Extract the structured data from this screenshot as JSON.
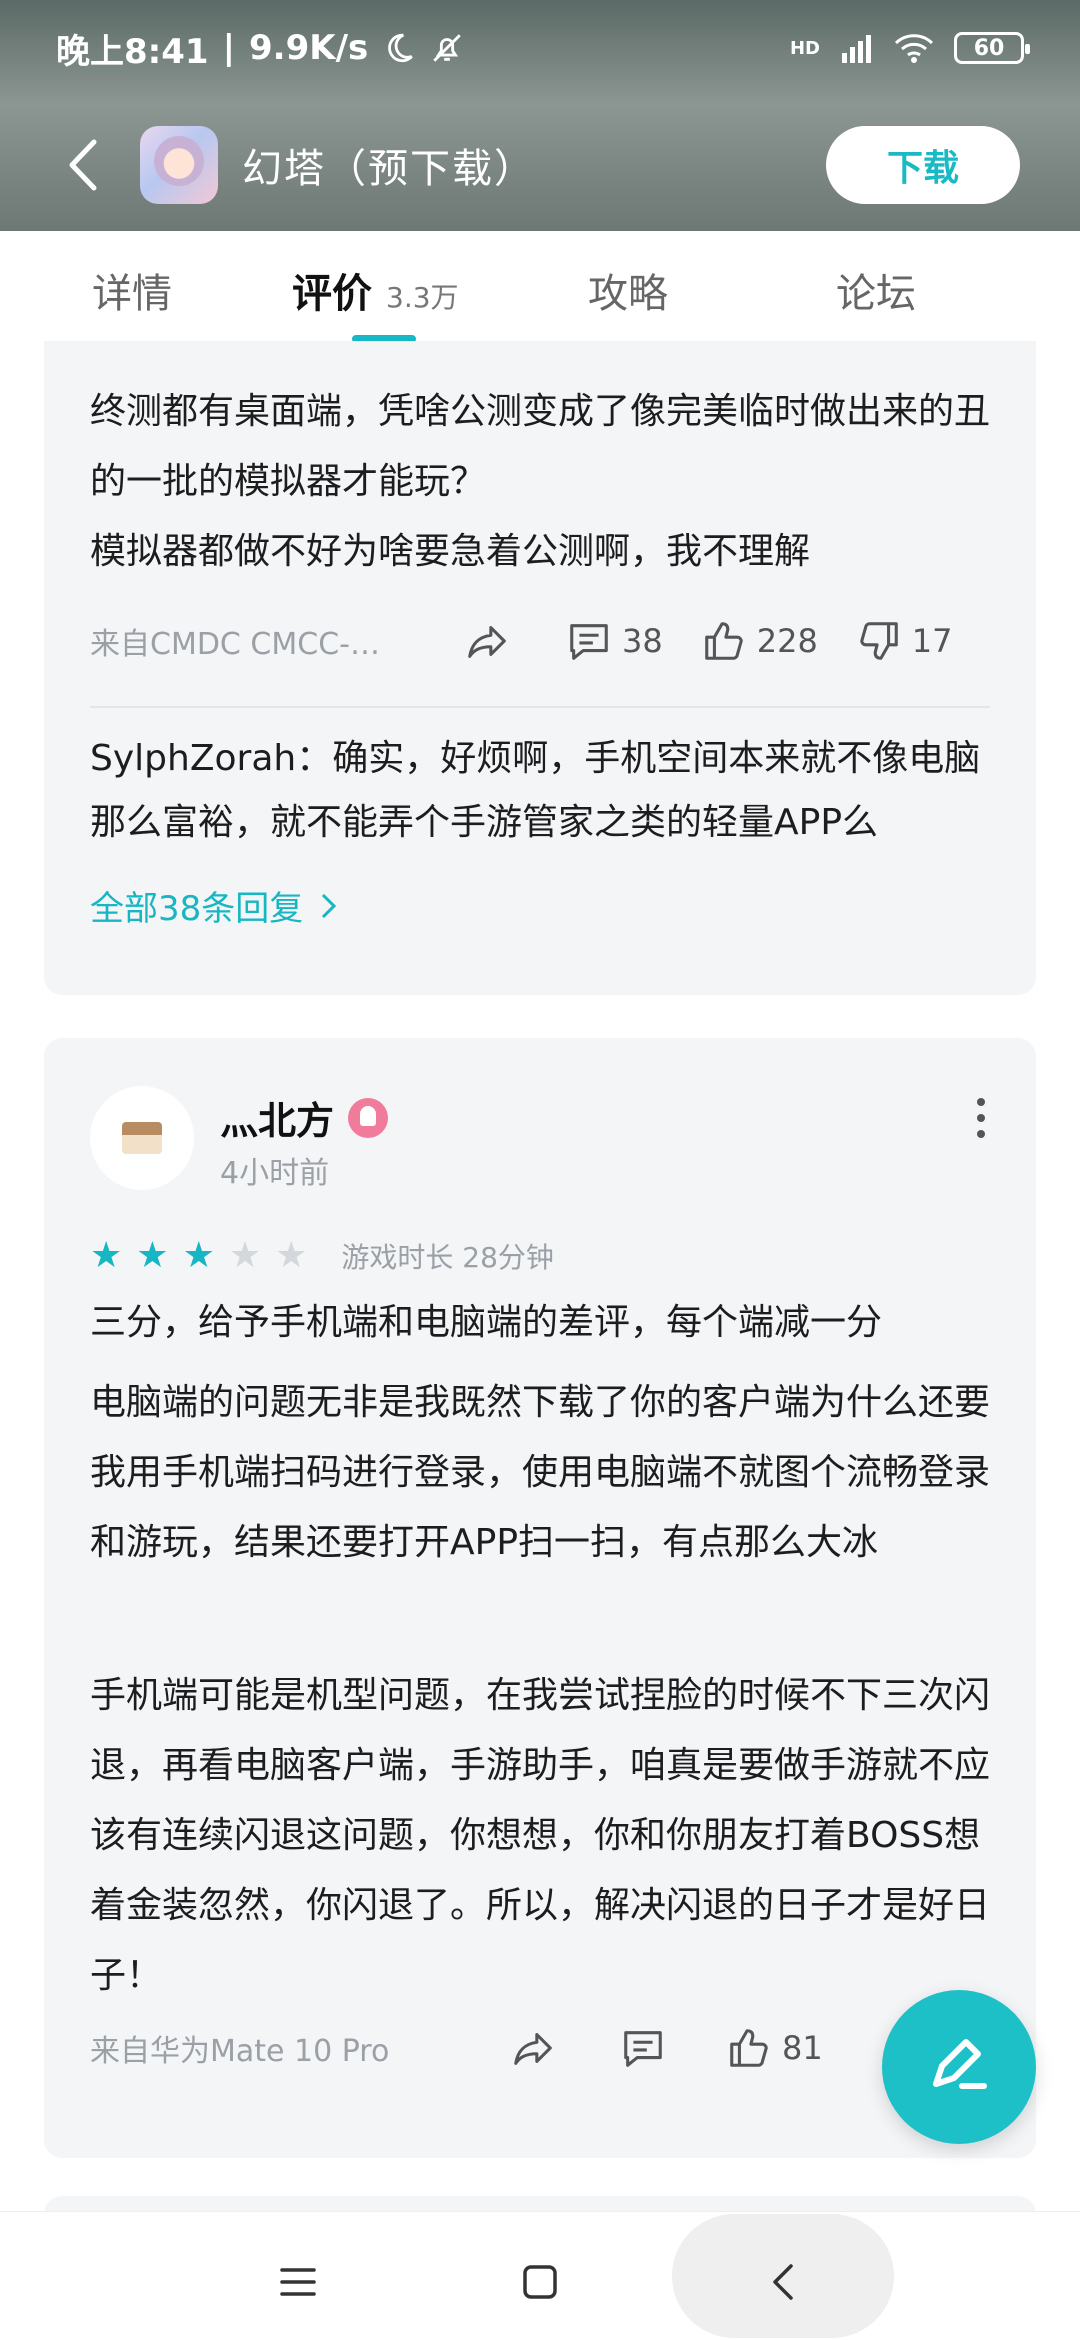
{
  "status_bar": {
    "time": "晚上8:41",
    "net_speed": "9.9K/s",
    "separator": "|",
    "signal_label": "HD",
    "battery": "60"
  },
  "header": {
    "app_title": "幻塔（预下载）",
    "download_label": "下载"
  },
  "tabs": [
    {
      "label": "详情"
    },
    {
      "label": "评价",
      "count": "3.3万"
    },
    {
      "label": "攻略"
    },
    {
      "label": "论坛"
    }
  ],
  "review1": {
    "para1": "终测都有桌面端，凭啥公测变成了像完美临时做出来的丑的一批的模拟器才能玩？",
    "para2": "模拟器都做不好为啥要急着公测啊，我不理解",
    "source": "来自CMDC CMCC-…",
    "comments": "38",
    "likes": "228",
    "dislikes": "17",
    "reply": "SylphZorah：确实，好烦啊，手机空间本来就不像电脑那么富裕，就不能弄个手游管家之类的轻量APP么",
    "all_replies": "全部38条回复"
  },
  "review2": {
    "username": "灬北方",
    "time_ago": "4小时前",
    "rating": 3,
    "max_rating": 5,
    "playtime": "游戏时长 28分钟",
    "para1": "三分，给予手机端和电脑端的差评，每个端减一分",
    "para2": "电脑端的问题无非是我既然下载了你的客户端为什么还要我用手机端扫码进行登录，使用电脑端不就图个流畅登录和游玩，结果还要打开APP扫一扫，有点那么大冰",
    "para3": "手机端可能是机型问题，在我尝试捏脸的时候不下三次闪退，再看电脑客户端，手游助手，咱真是要做手游就不应该有连续闪退这问题，你想想，你和你朋友打着BOSS想着金装忽然，你闪退了。所以，解决闪退的日子才是好日子！",
    "source": "来自华为Mate 10 Pro",
    "likes": "81"
  },
  "colors": {
    "accent": "#17b6c3",
    "card_bg": "#f4f5f7",
    "fab": "#1ec0c8"
  }
}
